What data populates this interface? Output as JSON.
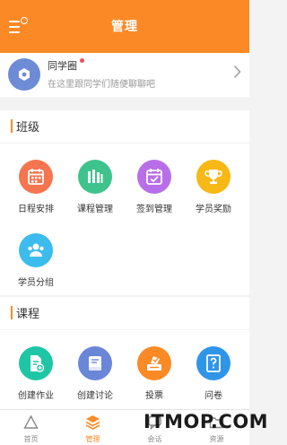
{
  "header": {
    "title": "管理"
  },
  "circle": {
    "name": "同学圈",
    "subtitle": "在这里跟同学们随便聊聊吧"
  },
  "class_section": {
    "title": "班级",
    "items": [
      {
        "label": "日程安排",
        "icon": "calendar-icon",
        "color": "#f5754f"
      },
      {
        "label": "课程管理",
        "icon": "bar-chart-icon",
        "color": "#3fc38d"
      },
      {
        "label": "签到管理",
        "icon": "check-calendar-icon",
        "color": "#b86ee8"
      },
      {
        "label": "学员奖励",
        "icon": "trophy-icon",
        "color": "#f8b815"
      },
      {
        "label": "学员分组",
        "icon": "group-icon",
        "color": "#3cbcec"
      }
    ]
  },
  "course_section": {
    "title": "课程",
    "items": [
      {
        "label": "创建作业",
        "icon": "homework-icon",
        "color": "#1fc6a6"
      },
      {
        "label": "创建讨论",
        "icon": "discussion-icon",
        "color": "#6a86d9"
      },
      {
        "label": "投票",
        "icon": "vote-icon",
        "color": "#fb8a26"
      },
      {
        "label": "问卷",
        "icon": "questionnaire-icon",
        "color": "#2f95e8"
      }
    ]
  },
  "tabbar": {
    "items": [
      {
        "label": "首页",
        "icon": "home-icon"
      },
      {
        "label": "管理",
        "icon": "layers-icon",
        "active": true
      },
      {
        "label": "会话",
        "icon": "chat-icon"
      },
      {
        "label": "资源",
        "icon": "folder-icon"
      }
    ]
  },
  "watermark": "ITMOP.COM",
  "colors": {
    "accent": "#fb8a26",
    "background": "#f3f3f3"
  }
}
